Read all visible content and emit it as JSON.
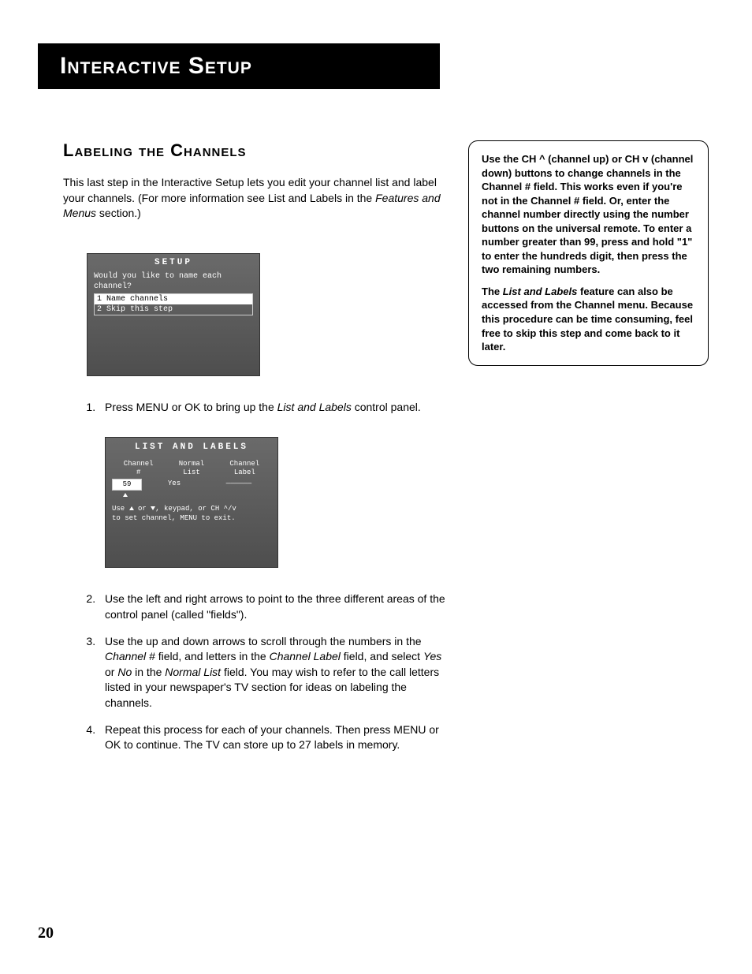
{
  "header": {
    "title": "Interactive Setup"
  },
  "section_title": "Labeling the Channels",
  "intro": {
    "line1": "This last step in the Interactive Setup lets you edit your channel list and label your channels. (For more information see List and Labels in the ",
    "ital": "Features and Menus",
    "line2": " section.)"
  },
  "setup_screen": {
    "title": "SETUP",
    "prompt1": "Would you like to name each",
    "prompt2": "channel?",
    "option1": "1 Name channels",
    "option2": "2 Skip this step"
  },
  "labels_screen": {
    "title": "LIST AND LABELS",
    "col1a": "Channel",
    "col1b": "#",
    "col2a": "Normal",
    "col2b": "List",
    "col3a": "Channel",
    "col3b": "Label",
    "val_channel": "59",
    "val_list": "Yes",
    "val_label": "——————",
    "hint1_a": "Use ",
    "hint1_b": " or ",
    "hint1_c": ", keypad,  or CH ^/v",
    "hint2": "to set channel, MENU to exit."
  },
  "steps": {
    "s1a": "Press MENU or OK to bring up the ",
    "s1i": "List and Labels",
    "s1b": " control panel.",
    "s2": "Use the left and right arrows to point to the three different areas of the control panel (called \"fields\").",
    "s3a": "Use the up and down arrows to scroll through the numbers in the ",
    "s3i1": "Channel #",
    "s3b": " field, and letters in the ",
    "s3i2": "Channel Label",
    "s3c": " field, and select ",
    "s3i3": "Yes",
    "s3d": " or ",
    "s3i4": "No",
    "s3e": " in the ",
    "s3i5": "Normal List",
    "s3f": " field. You may wish to refer to the call letters listed in your newspaper's TV section for ideas on labeling the channels.",
    "s4": "Repeat this process for each of your channels. Then press MENU or OK to continue. The TV can store up to 27 labels in memory."
  },
  "sidebar": {
    "p1": "Use the CH ^ (channel up) or CH v (channel down) buttons to change channels in the Channel # field. This works even if you're not in the Channel # field. Or, enter the channel number directly using the number buttons on the universal remote. To enter a number greater than 99, press and hold \"1\" to enter the hundreds digit, then press the two remaining numbers.",
    "p2a": "The ",
    "p2i": "List and Labels",
    "p2b": " feature can also be accessed from the Channel menu. Because this procedure can be time consuming, feel free to skip this step and come back to it later."
  },
  "page_number": "20"
}
